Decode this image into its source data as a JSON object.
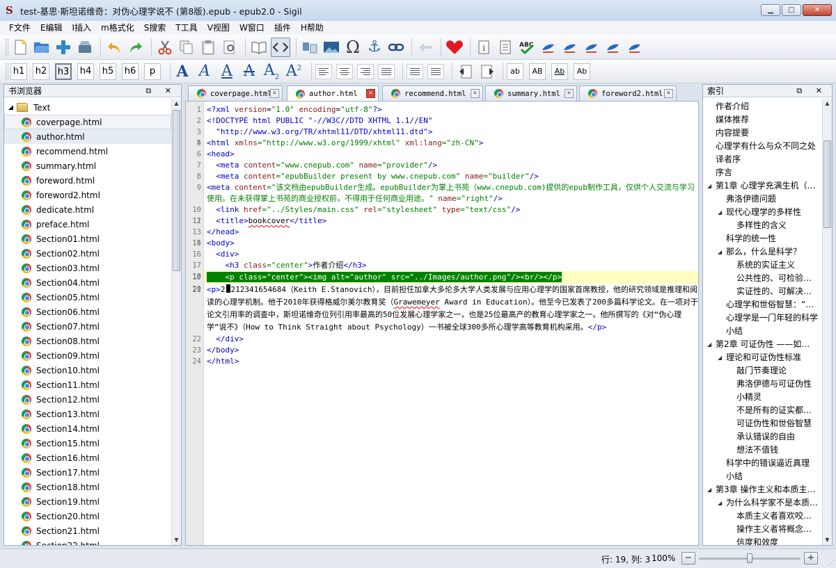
{
  "window": {
    "title": "test-基思·斯坦诺维奇：对伪心理学说不 (第8版).epub - epub2.0 - Sigil",
    "app_logo": "S",
    "minimize": "▁",
    "maximize": "□",
    "close": "✕"
  },
  "menu": [
    "F文件",
    "E编辑",
    "I插入",
    "m格式化",
    "S搜索",
    "T工具",
    "V视图",
    "W窗口",
    "插件",
    "H帮助"
  ],
  "headings": [
    "h1",
    "h2",
    "h3",
    "h4",
    "h5",
    "h6",
    "p"
  ],
  "case_buttons": [
    "ab",
    "AB",
    "Ab",
    "Ab"
  ],
  "book_browser": {
    "title": "书浏览器",
    "header_icons": "⧉ ✕",
    "folder": "Text",
    "files": [
      "coverpage.html",
      "author.html",
      "recommend.html",
      "summary.html",
      "foreword.html",
      "foreword2.html",
      "dedicate.html",
      "preface.html",
      "Section01.html",
      "Section02.html",
      "Section03.html",
      "Section04.html",
      "Section05.html",
      "Section06.html",
      "Section07.html",
      "Section08.html",
      "Section09.html",
      "Section10.html",
      "Section11.html",
      "Section12.html",
      "Section13.html",
      "Section14.html",
      "Section15.html",
      "Section16.html",
      "Section17.html",
      "Section18.html",
      "Section19.html",
      "Section20.html",
      "Section21.html",
      "Section22.html"
    ]
  },
  "tabs": [
    {
      "label": "coverpage.html",
      "close": "✕"
    },
    {
      "label": "author.html",
      "close": "✕"
    },
    {
      "label": "recommend.html",
      "close": "✕"
    },
    {
      "label": "summary.html",
      "close": "✕"
    },
    {
      "label": "foreword2.html",
      "close": "✕"
    }
  ],
  "code": {
    "line_numbers": [
      "1",
      "2",
      "3",
      "4",
      "5",
      "6",
      "7",
      "8",
      "9",
      "10",
      "11",
      "12",
      "13",
      "14",
      "15",
      "16",
      "17",
      "18",
      "19",
      "20",
      "21",
      "22",
      "23",
      "24"
    ],
    "l1": {
      "t1": "<?xml ",
      "a1": "version",
      "e1": "=",
      "v1": "\"1.0\"",
      "a2": " encoding",
      "e2": "=",
      "v2": "\"utf-8\"",
      "t2": "?>"
    },
    "l2": "<!DOCTYPE html PUBLIC \"-//W3C//DTD XHTML 1.1//EN\"",
    "l3": "  \"http://www.w3.org/TR/xhtml11/DTD/xhtml11.dtd\">",
    "l5": {
      "t1": "<html ",
      "a1": "xmlns",
      "v1": "=\"http://www.w3.org/1999/xhtml\"",
      "a2": " xml:lang",
      "v2": "=\"zh-CN\"",
      "t2": ">"
    },
    "l6": "<head>",
    "l7": {
      "t1": "  <meta ",
      "a1": "content",
      "v1": "=\"www.cnepub.com\"",
      "a2": " name",
      "v2": "=\"provider\"",
      "t2": "/>"
    },
    "l8": {
      "t1": "  <meta ",
      "a1": "content",
      "v1": "=\"epubBuilder present by www.cnepub.com\"",
      "a2": " name",
      "v2": "=\"builder\"",
      "t2": "/>"
    },
    "l9": {
      "t1": "  <meta ",
      "a1": "content",
      "v1": "=\"该文档由epubBuilder生成。epubBuilder为掌上书苑（www.cnepub.com)提供的epub制作工具，仅供个人交流与学习使用。在未获得掌上书苑的商业授权前，不得用于任何商业用途。\"",
      "a2": " name",
      "v2": "=\"right\"",
      "t2": "/>"
    },
    "l10": {
      "t1": "  <link ",
      "a1": "href",
      "v1": "=\"../Styles/main.css\"",
      "a2": " rel",
      "v2": "=\"stylesheet\"",
      "a3": " type",
      "v3": "=\"text/css\"",
      "t2": "/>"
    },
    "l12": {
      "t1": "  <title>",
      "text": "bookcover",
      "t2": "</title>"
    },
    "l13": "</head>",
    "l15": "<body>",
    "l16": "  <div>",
    "l17": {
      "t1": "    <h3 ",
      "a1": "class",
      "v1": "=\"center\"",
      "t2": ">",
      "text": "作者介绍",
      "t3": "</h3>"
    },
    "l19": "    <p class=\"center\"><img alt=\"author\" src=\"../Images/author.png\"/><br/></p>",
    "l21": {
      "t1": "    <p>",
      "pre": "2",
      "body_a": "212341654684（Keith E.Stanovich），目前担任加拿大多伦多大学人类发展与应用心理学的国家首席教授，他的研究领域是推理和阅读的心理学机制。他于2010年获得格威尔美尔教育奖（",
      "squig": "Grawemeyer",
      "body_b": " Award in Education）。他至今已发表了200多篇科学论文。在一项对于论文引用率的调查中，斯坦诺维奇位列引用率最高的50位发展心理学家之一，也是25位最高产的教育心理学家之一。他所撰写的《对“伪心理学”说不》（How to Think Straight about Psychology）一书被全球300多所心理学高等教育机构采用。",
      "t2": "</p>"
    },
    "l22": "  </div>",
    "l23": "</body>",
    "l24": "</html>"
  },
  "index_panel": {
    "title": "索引",
    "header_icons": "⧉ ✕",
    "items": [
      {
        "label": "作者介绍",
        "level": 0,
        "arrow": ""
      },
      {
        "label": "媒体推荐",
        "level": 0,
        "arrow": ""
      },
      {
        "label": "内容提要",
        "level": 0,
        "arrow": ""
      },
      {
        "label": "心理学有什么与众不同之处",
        "level": 0,
        "arrow": ""
      },
      {
        "label": "译者序",
        "level": 0,
        "arrow": ""
      },
      {
        "label": "序言",
        "level": 0,
        "arrow": ""
      },
      {
        "label": "第1章 心理学充满生机（…",
        "level": 0,
        "arrow": "◢"
      },
      {
        "label": "弗洛伊德问题",
        "level": 1,
        "arrow": ""
      },
      {
        "label": "现代心理学的多样性",
        "level": 1,
        "arrow": "◢"
      },
      {
        "label": "多样性的含义",
        "level": 2,
        "arrow": ""
      },
      {
        "label": "科学的统一性",
        "level": 1,
        "arrow": ""
      },
      {
        "label": "那么，什么是科学？",
        "level": 1,
        "arrow": "◢"
      },
      {
        "label": "系统的实证主义",
        "level": 2,
        "arrow": ""
      },
      {
        "label": "公共性的、可检验…",
        "level": 2,
        "arrow": ""
      },
      {
        "label": "实证性的、可解决…",
        "level": 2,
        "arrow": ""
      },
      {
        "label": "心理学和世俗智慧：“…",
        "level": 1,
        "arrow": ""
      },
      {
        "label": "心理学是一门年轻的科学",
        "level": 1,
        "arrow": ""
      },
      {
        "label": "小结",
        "level": 1,
        "arrow": ""
      },
      {
        "label": "第2章 可证伪性 ——如…",
        "level": 0,
        "arrow": "◢"
      },
      {
        "label": "理论和可证伪性标准",
        "level": 1,
        "arrow": "◢"
      },
      {
        "label": "敲门节奏理论",
        "level": 2,
        "arrow": ""
      },
      {
        "label": "弗洛伊德与可证伪性",
        "level": 2,
        "arrow": ""
      },
      {
        "label": "小精灵",
        "level": 2,
        "arrow": ""
      },
      {
        "label": "不是所有的证实都…",
        "level": 2,
        "arrow": ""
      },
      {
        "label": "可证伪性和世俗智慧",
        "level": 2,
        "arrow": ""
      },
      {
        "label": "承认错误的自由",
        "level": 2,
        "arrow": ""
      },
      {
        "label": "想法不值钱",
        "level": 2,
        "arrow": ""
      },
      {
        "label": "科学中的错误逼近真理",
        "level": 1,
        "arrow": ""
      },
      {
        "label": "小结",
        "level": 1,
        "arrow": ""
      },
      {
        "label": "第3章 操作主义和本质主…",
        "level": 0,
        "arrow": "◢"
      },
      {
        "label": "为什么科学家不是本质…",
        "level": 1,
        "arrow": "◢"
      },
      {
        "label": "本质主义者喜欢咬…",
        "level": 2,
        "arrow": ""
      },
      {
        "label": "操作主义者将概念…",
        "level": 2,
        "arrow": ""
      },
      {
        "label": "信度和效度",
        "level": 2,
        "arrow": ""
      }
    ]
  },
  "status": {
    "position": "行: 19, 列: 3",
    "zoom": "100%",
    "zoom_fraction": 0.5,
    "zoom_out": "−",
    "zoom_in": "+"
  },
  "colors": {
    "highlight_line": "#ffffbf",
    "selection": "#008200",
    "tag": "#0000c8",
    "attr": "#8b1a1a",
    "value": "#008000"
  },
  "icons": {
    "new": "new-file-icon",
    "open": "open-folder-icon",
    "add": "add-file-icon",
    "save": "save-icon",
    "undo": "undo-icon",
    "redo": "redo-icon",
    "cut": "cut-icon",
    "copy": "copy-icon",
    "paste": "paste-icon",
    "preview": "preview-icon",
    "book_view": "book-view-icon",
    "code_view": "code-view-icon",
    "split": "split-icon",
    "image": "insert-image-icon",
    "special_char": "omega-icon",
    "anchor": "anchor-icon",
    "link": "link-icon",
    "back": "back-icon",
    "heart": "heart-icon",
    "metadata": "metadata-icon",
    "toc": "toc-icon",
    "spellcheck": "spellcheck-icon"
  }
}
